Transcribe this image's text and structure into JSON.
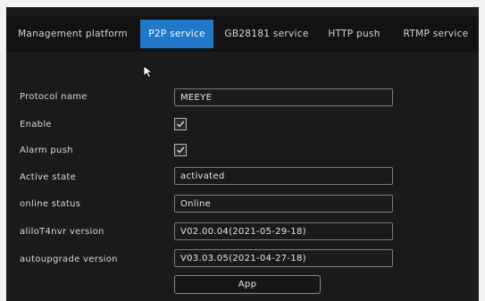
{
  "tabs": [
    {
      "label": "Management platform",
      "active": false
    },
    {
      "label": "P2P service",
      "active": true
    },
    {
      "label": "GB28181 service",
      "active": false
    },
    {
      "label": "HTTP push",
      "active": false
    },
    {
      "label": "RTMP service",
      "active": false
    }
  ],
  "form": {
    "protocol_name": {
      "label": "Protocol name",
      "value": "MEEYE"
    },
    "enable": {
      "label": "Enable",
      "checked": true
    },
    "alarm_push": {
      "label": "Alarm push",
      "checked": true
    },
    "active_state": {
      "label": "Active state",
      "value": "activated"
    },
    "online_status": {
      "label": "online status",
      "value": "Online"
    },
    "alilo_version": {
      "label": "aliloT4nvr version",
      "value": "V02.00.04(2021-05-29-18)"
    },
    "autoupgrade_version": {
      "label": "autoupgrade version",
      "value": "V03.03.05(2021-04-27-18)"
    }
  },
  "app_button_label": "App",
  "colors": {
    "active_tab": "#1f78c8",
    "panel_background": "#1a1a1a"
  }
}
